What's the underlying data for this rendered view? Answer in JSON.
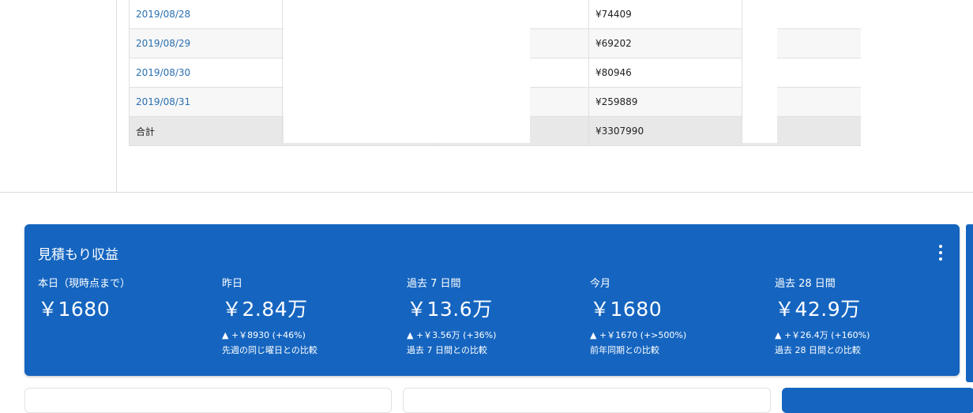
{
  "table": {
    "rows": [
      {
        "date": "2019/08/28",
        "value": "¥74409"
      },
      {
        "date": "2019/08/29",
        "value": "¥69202"
      },
      {
        "date": "2019/08/30",
        "value": "¥80946"
      },
      {
        "date": "2019/08/31",
        "value": "¥259889"
      }
    ],
    "total": {
      "label": "合計",
      "value": "¥3307990"
    }
  },
  "earnings": {
    "title": "見積もり収益",
    "metrics": [
      {
        "label": "本日（現時点まで）",
        "value": "￥1680",
        "delta": "",
        "compare": ""
      },
      {
        "label": "昨日",
        "value": "￥2.84万",
        "delta": "▲ +￥8930 (+46%)",
        "compare": "先週の同じ曜日との比較"
      },
      {
        "label": "過去 7 日間",
        "value": "￥13.6万",
        "delta": "▲ +￥3.56万 (+36%)",
        "compare": "過去 7 日間との比較"
      },
      {
        "label": "今月",
        "value": "￥1680",
        "delta": "▲ +￥1670 (+>500%)",
        "compare": "前年同期との比較"
      },
      {
        "label": "過去 28 日間",
        "value": "￥42.9万",
        "delta": "▲ +￥26.4万 (+160%)",
        "compare": "過去 28 日間との比較"
      }
    ],
    "accent_color": "#1565c0"
  },
  "icons": {
    "menu": "more-vert-icon"
  }
}
